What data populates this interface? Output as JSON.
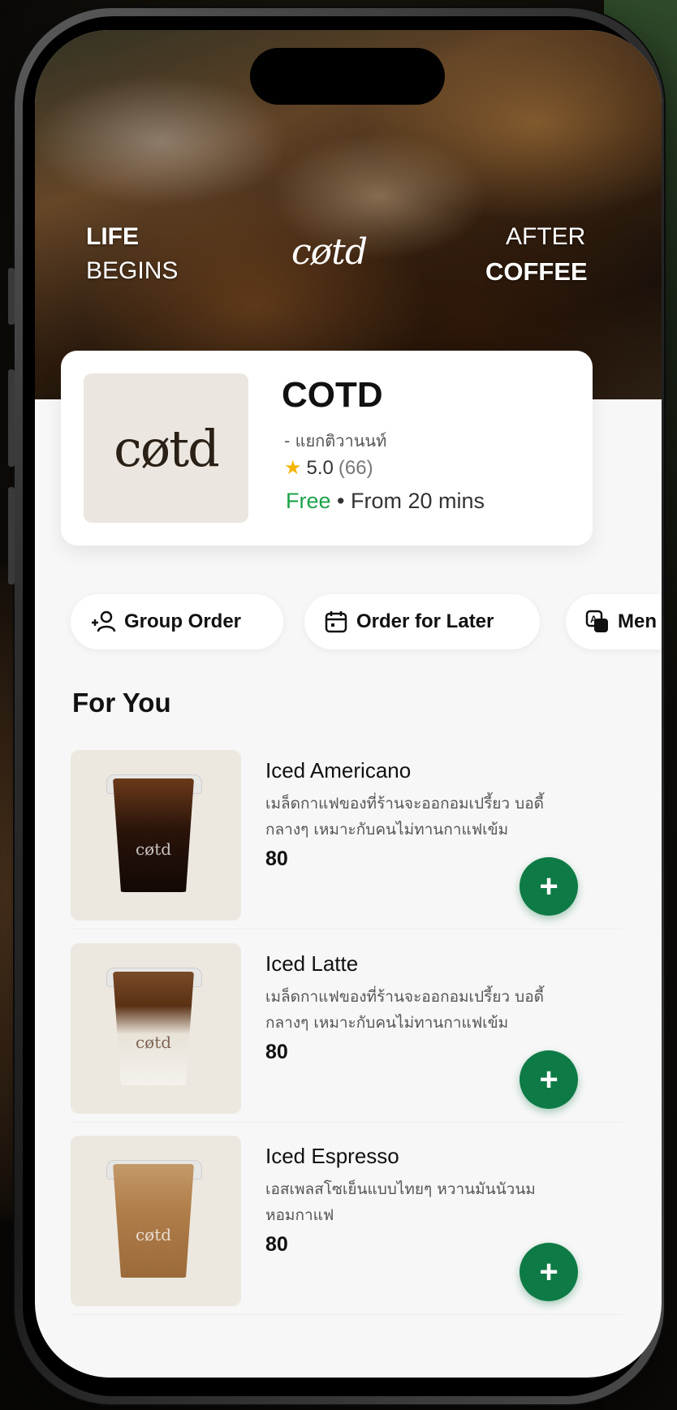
{
  "hero": {
    "left_line1": "LIFE",
    "left_line2": "BEGINS",
    "right_line1": "AFTER",
    "right_line2": "COFFEE",
    "logo": "cøtd"
  },
  "store": {
    "logo": "cøtd",
    "name": "COTD",
    "branch": "- แยกติวานนท์",
    "rating": "5.0",
    "rating_count": "(66)",
    "delivery_fee": "Free",
    "delivery_time": "• From 20 mins"
  },
  "actions": {
    "group_order": "Group Order",
    "order_later": "Order for Later",
    "menu": "Men"
  },
  "section": {
    "title": "For You"
  },
  "items": [
    {
      "name": "Iced Americano",
      "desc": "เมล็ดกาแฟของที่ร้านจะออกอมเปรี้ยว บอดี้กลางๆ เหมาะกับคนไม่ทานกาแฟเข้ม",
      "price": "80",
      "cup_label": "cøtd"
    },
    {
      "name": "Iced Latte",
      "desc": "เมล็ดกาแฟของที่ร้านจะออกอมเปรี้ยว บอดี้กลางๆ เหมาะกับคนไม่ทานกาแฟเข้ม",
      "price": "80",
      "cup_label": "cøtd"
    },
    {
      "name": "Iced Espresso",
      "desc": "เอสเพลสโซเย็นแบบไทยๆ หวานมันนัวนม หอมกาแฟ",
      "price": "80",
      "cup_label": "cøtd"
    }
  ],
  "colors": {
    "accent_green": "#0e7a45",
    "free_green": "#1aa34a",
    "star": "#f5b400"
  }
}
